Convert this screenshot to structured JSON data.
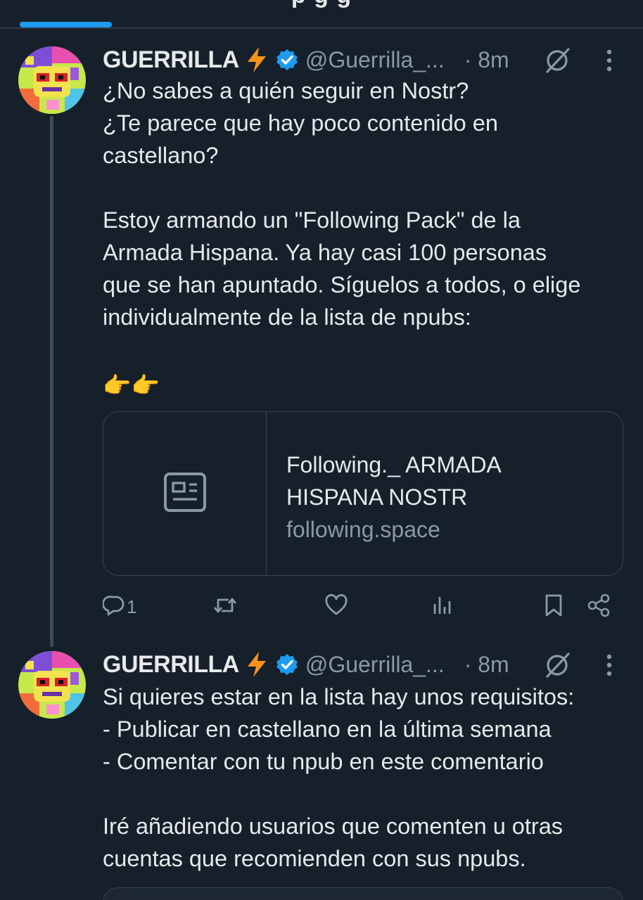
{
  "header": {
    "cut_title": "p  g g"
  },
  "posts": [
    {
      "display_name": "GUERRILLA",
      "handle": "@Guerrilla_...",
      "time": "· 8m",
      "body": [
        "¿No sabes a quién seguir en Nostr?",
        "¿Te parece que hay poco contenido en",
        "castellano?",
        "",
        "Estoy armando un \"Following Pack\" de la",
        "Armada Hispana. Ya hay casi 100 personas",
        "que se han apuntado. Síguelos a todos, o elige",
        "individualmente de la lista de npubs:",
        "",
        "👉👉"
      ],
      "link_card": {
        "title_line1": "Following._ ARMADA",
        "title_line2": "HISPANA NOSTR",
        "domain": "following.space"
      },
      "actions": {
        "reply_count": "1"
      }
    },
    {
      "display_name": "GUERRILLA",
      "handle": "@Guerrilla_...",
      "time": "· 8m",
      "body": [
        "Si quieres estar en la lista hay unos requisitos:",
        "- Publicar en castellano en la última semana",
        "- Comentar con tu npub en este comentario",
        "",
        "Iré añadiendo usuarios que comenten u otras",
        "cuentas que recomienden con sus npubs."
      ]
    }
  ],
  "colors": {
    "background": "#15202b",
    "accent": "#1d9bf0",
    "bolt": "#f7931a",
    "muted": "#8b98a5",
    "border": "#38444d"
  },
  "icons": [
    "lightning-icon",
    "verified-badge-icon",
    "grok-icon",
    "more-icon",
    "article-icon",
    "reply-icon",
    "retweet-icon",
    "like-icon",
    "views-icon",
    "bookmark-icon",
    "share-icon"
  ]
}
